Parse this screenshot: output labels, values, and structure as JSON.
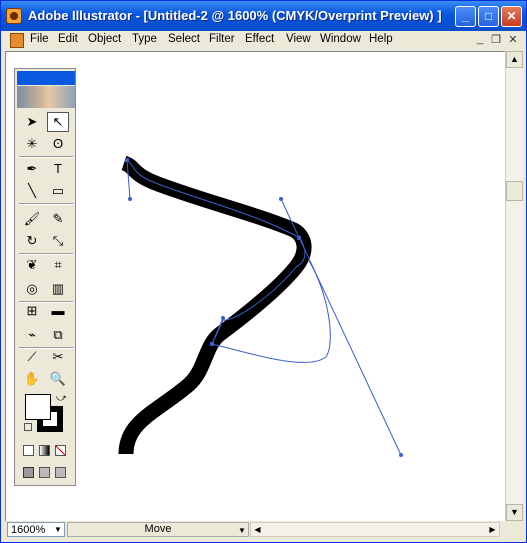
{
  "window": {
    "title": "Adobe Illustrator - [Untitled-2 @ 1600% (CMYK/Overprint Preview) ]",
    "minimize_glyph": "_",
    "maximize_glyph": "□",
    "close_glyph": "✕"
  },
  "menubar": {
    "items": [
      "File",
      "Edit",
      "Object",
      "Type",
      "Select",
      "Filter",
      "Effect",
      "View",
      "Window",
      "Help"
    ],
    "doc_controls": [
      "_",
      "❐",
      "✕"
    ]
  },
  "toolbox": {
    "tools": [
      {
        "icon": "selection-tool-icon",
        "glyph": "➤"
      },
      {
        "icon": "direct-selection-tool-icon",
        "glyph": "↖"
      },
      {
        "icon": "magic-wand-tool-icon",
        "glyph": "✳"
      },
      {
        "icon": "lasso-tool-icon",
        "glyph": "ʘ"
      },
      {
        "icon": "pen-tool-icon",
        "glyph": "✒"
      },
      {
        "icon": "type-tool-icon",
        "glyph": "T"
      },
      {
        "icon": "line-segment-tool-icon",
        "glyph": "╲"
      },
      {
        "icon": "rectangle-tool-icon",
        "glyph": "▭"
      },
      {
        "icon": "paintbrush-tool-icon",
        "glyph": "🖌"
      },
      {
        "icon": "pencil-tool-icon",
        "glyph": "✎"
      },
      {
        "icon": "rotate-tool-icon",
        "glyph": "↻"
      },
      {
        "icon": "scale-tool-icon",
        "glyph": "⤡"
      },
      {
        "icon": "warp-tool-icon",
        "glyph": "❦"
      },
      {
        "icon": "free-transform-tool-icon",
        "glyph": "⌗"
      },
      {
        "icon": "symbol-sprayer-tool-icon",
        "glyph": "◎"
      },
      {
        "icon": "column-graph-tool-icon",
        "glyph": "▥"
      },
      {
        "icon": "mesh-tool-icon",
        "glyph": "⊞"
      },
      {
        "icon": "gradient-tool-icon",
        "glyph": "▬"
      },
      {
        "icon": "eyedropper-tool-icon",
        "glyph": "⌁"
      },
      {
        "icon": "blend-tool-icon",
        "glyph": "⧉"
      },
      {
        "icon": "slice-tool-icon",
        "glyph": "⟋"
      },
      {
        "icon": "scissors-tool-icon",
        "glyph": "✂"
      },
      {
        "icon": "hand-tool-icon",
        "glyph": "✋"
      },
      {
        "icon": "zoom-tool-icon",
        "glyph": "🔍"
      }
    ],
    "selected_tool": "direct-selection-tool-icon"
  },
  "statusbar": {
    "zoom": "1600%",
    "status_text": "Move"
  },
  "colors": {
    "selection_blue": "#3a5fcd",
    "stroke": "#000000",
    "titlebar": "#0a5ae0"
  }
}
